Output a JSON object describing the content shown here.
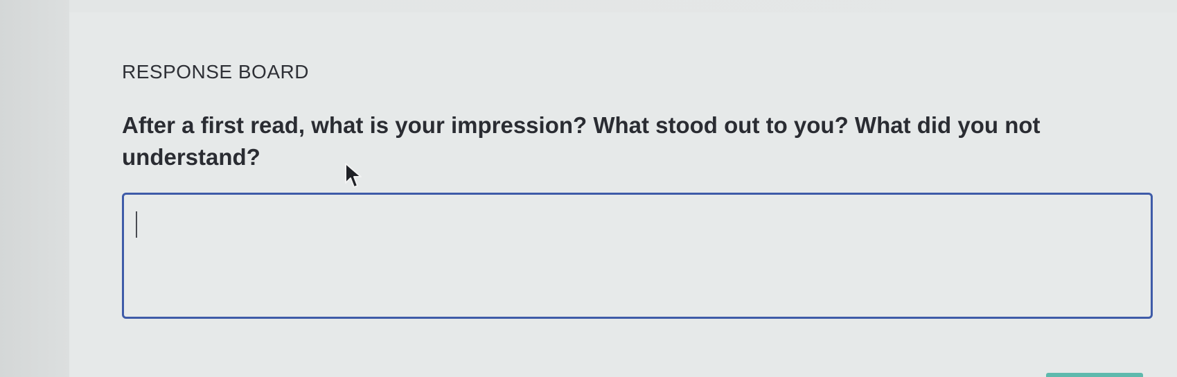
{
  "section": {
    "label": "RESPONSE BOARD"
  },
  "prompt": {
    "question": "After a first read, what is your impression? What stood out to you? What did you not understand?"
  },
  "response": {
    "value": "",
    "placeholder": ""
  },
  "cursor": {
    "icon": "mouse-pointer-icon"
  },
  "colors": {
    "input_border": "#3e5ba8",
    "text": "#2a2c32",
    "background": "#e6e9e9",
    "bottom_tab": "#5fb9ad"
  }
}
